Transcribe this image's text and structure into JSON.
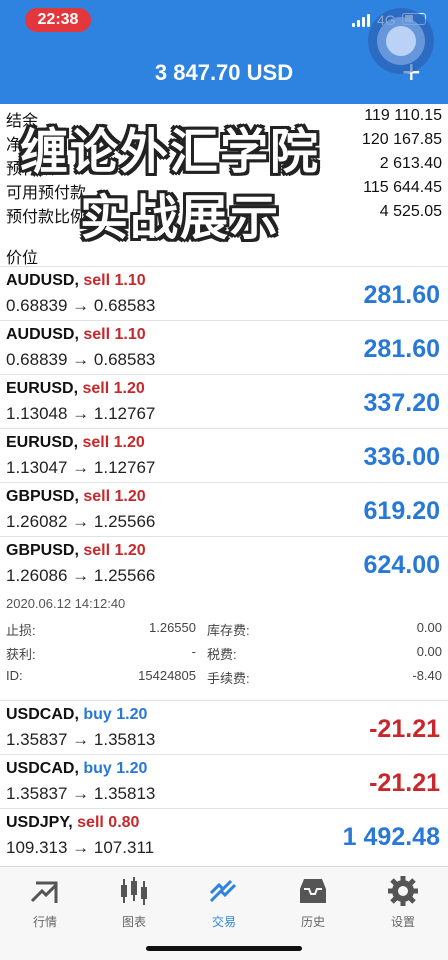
{
  "status_bar": {
    "time": "22:38",
    "network": "4G"
  },
  "header": {
    "balance": "3 847.70 USD"
  },
  "summary": [
    {
      "label": "结余",
      "value": "119 110.15"
    },
    {
      "label": "净值",
      "value": "120 167.85"
    },
    {
      "label": "预付款:",
      "value": "2 613.40"
    },
    {
      "label": "可用预付款",
      "value": "115 644.45"
    },
    {
      "label": "预付款比例",
      "value": "4 525.05"
    }
  ],
  "overlay": {
    "line1": "缠论外汇学院",
    "line2": "实战展示"
  },
  "section_title": "价位",
  "positions_top": [
    {
      "symbol": "AUDUSD,",
      "side": "sell 1.10",
      "side_type": "sell",
      "prices": "0.68839 → 0.68583",
      "profit": "281.60",
      "sign": "pos"
    },
    {
      "symbol": "AUDUSD,",
      "side": "sell 1.10",
      "side_type": "sell",
      "prices": "0.68839 → 0.68583",
      "profit": "281.60",
      "sign": "pos"
    },
    {
      "symbol": "EURUSD,",
      "side": "sell 1.20",
      "side_type": "sell",
      "prices": "1.13048 → 1.12767",
      "profit": "337.20",
      "sign": "pos"
    },
    {
      "symbol": "EURUSD,",
      "side": "sell 1.20",
      "side_type": "sell",
      "prices": "1.13047 → 1.12767",
      "profit": "336.00",
      "sign": "pos"
    },
    {
      "symbol": "GBPUSD,",
      "side": "sell 1.20",
      "side_type": "sell",
      "prices": "1.26082 → 1.25566",
      "profit": "619.20",
      "sign": "pos"
    },
    {
      "symbol": "GBPUSD,",
      "side": "sell 1.20",
      "side_type": "sell",
      "prices": "1.26086 → 1.25566",
      "profit": "624.00",
      "sign": "pos"
    }
  ],
  "detail": {
    "date": "2020.06.12 14:12:40",
    "rows": [
      {
        "k1": "止损:",
        "v1": "1.26550",
        "k2": "库存费:",
        "v2": "0.00"
      },
      {
        "k1": "获利:",
        "v1": "-",
        "k2": "税费:",
        "v2": "0.00"
      },
      {
        "k1": "ID:",
        "v1": "15424805",
        "k2": "手续费:",
        "v2": "-8.40"
      }
    ]
  },
  "positions_bottom": [
    {
      "symbol": "USDCAD,",
      "side": "buy 1.20",
      "side_type": "buy",
      "prices": "1.35837 → 1.35813",
      "profit": "-21.21",
      "sign": "neg"
    },
    {
      "symbol": "USDCAD,",
      "side": "buy 1.20",
      "side_type": "buy",
      "prices": "1.35837 → 1.35813",
      "profit": "-21.21",
      "sign": "neg"
    },
    {
      "symbol": "USDJPY,",
      "side": "sell 0.80",
      "side_type": "sell",
      "prices": "109.313 → 107.311",
      "profit": "1 492.48",
      "sign": "pos"
    }
  ],
  "tabs": [
    {
      "label": "行情",
      "icon": "quotes-icon"
    },
    {
      "label": "图表",
      "icon": "chart-icon"
    },
    {
      "label": "交易",
      "icon": "trade-icon"
    },
    {
      "label": "历史",
      "icon": "history-icon"
    },
    {
      "label": "设置",
      "icon": "settings-icon"
    }
  ],
  "colors": {
    "accent": "#2f83e0",
    "sell": "#c8282b",
    "buy": "#2878d8",
    "time_pill": "#e2373c"
  }
}
